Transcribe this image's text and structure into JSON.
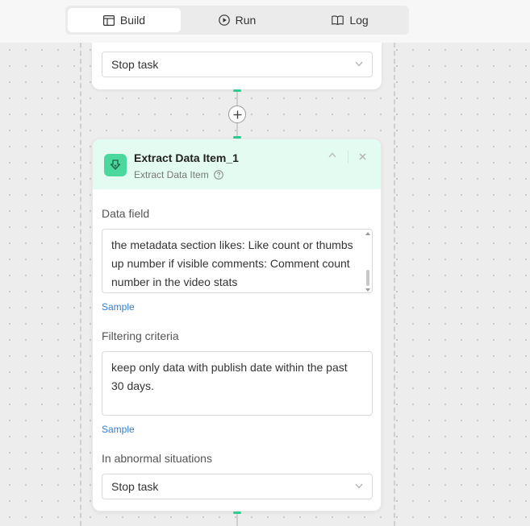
{
  "toolbar": {
    "tabs": [
      {
        "label": "Build",
        "icon": "layout-icon",
        "active": true
      },
      {
        "label": "Run",
        "icon": "play-icon",
        "active": false
      },
      {
        "label": "Log",
        "icon": "book-icon",
        "active": false
      }
    ]
  },
  "previous_node": {
    "abnormal_value": "Stop task"
  },
  "node": {
    "title": "Extract Data Item_1",
    "subtitle": "Extract Data Item",
    "data_field_label": "Data field",
    "data_field_value": "the metadata section likes: Like count or thumbs up number if visible comments: Comment count number in the video stats",
    "sample_label": "Sample",
    "filter_label": "Filtering criteria",
    "filter_value": "keep only data with publish date within the past 30 days.",
    "sample_label_2": "Sample",
    "abnormal_label": "In abnormal situations",
    "abnormal_value": "Stop task"
  },
  "colors": {
    "accent_green": "#2ecc8f",
    "header_green": "#e3fbf0",
    "icon_green": "#4bd89c",
    "link_blue": "#2f7fd8"
  }
}
